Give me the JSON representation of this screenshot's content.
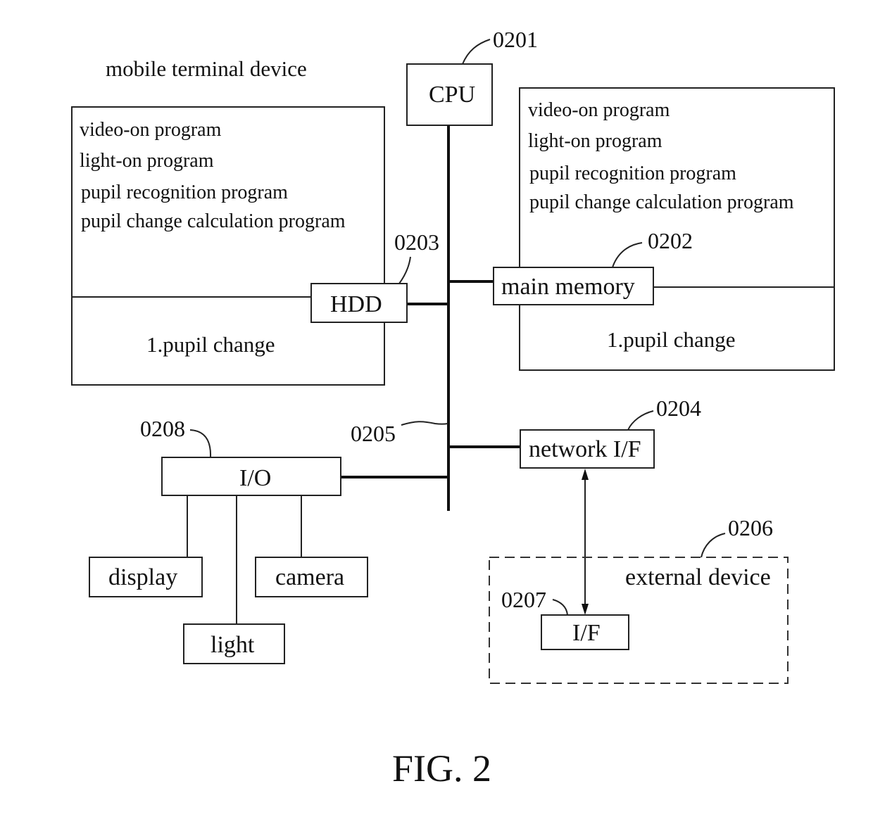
{
  "figure": {
    "caption": "FIG. 2",
    "title": "mobile terminal device"
  },
  "cpu": {
    "label": "CPU",
    "ref": "0201"
  },
  "main_memory": {
    "label": "main memory",
    "ref": "0202",
    "programs": [
      "video-on program",
      "light-on program",
      "pupil recognition program",
      "pupil change calculation program"
    ],
    "data": "1.pupil change"
  },
  "hdd": {
    "label": "HDD",
    "ref": "0203",
    "programs": [
      "video-on program",
      "light-on program",
      "pupil recognition program",
      "pupil change calculation program"
    ],
    "data": "1.pupil change"
  },
  "network_if": {
    "label": "network I/F",
    "ref": "0204"
  },
  "bus": {
    "ref": "0205"
  },
  "external_device": {
    "label": "external device",
    "ref": "0206"
  },
  "ext_if": {
    "label": "I/F",
    "ref": "0207"
  },
  "io": {
    "label": "I/O",
    "ref": "0208"
  },
  "peripherals": {
    "display": "display",
    "light": "light",
    "camera": "camera"
  },
  "colors": {
    "ink": "#111111",
    "background": "#ffffff"
  }
}
